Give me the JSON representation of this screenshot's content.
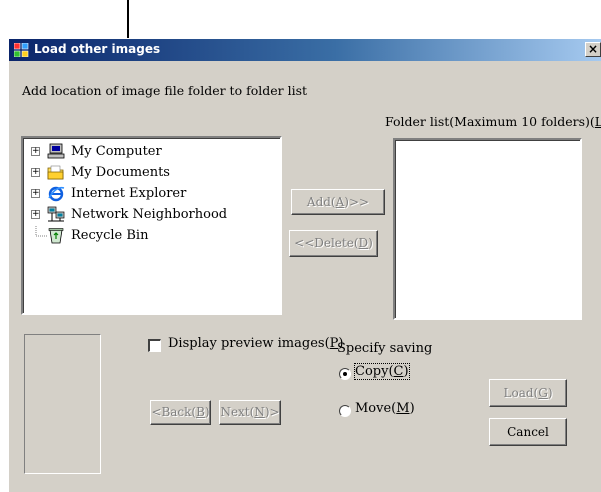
{
  "window": {
    "title": "Load other images",
    "close_glyph": "×"
  },
  "folder_location_label": "Add location of image file folder to folder list",
  "folder_list_label_prefix": "Folder list(Maximum 10 folders)(",
  "folder_list_label_key": "L",
  "folder_list_label_suffix": ")",
  "tree": [
    {
      "label": "My Computer",
      "icon": "my-computer-icon",
      "expandable": true
    },
    {
      "label": "My Documents",
      "icon": "folder-icon",
      "expandable": true
    },
    {
      "label": "Internet Explorer",
      "icon": "internet-explorer-icon",
      "expandable": true
    },
    {
      "label": "Network Neighborhood",
      "icon": "network-icon",
      "expandable": true
    },
    {
      "label": "Recycle Bin",
      "icon": "recycle-bin-icon",
      "expandable": false
    }
  ],
  "expand_glyph": "+",
  "buttons": {
    "add": {
      "prefix": "Add(",
      "key": "A",
      "suffix": ")>>"
    },
    "delete": {
      "prefix": "<<Delete(",
      "key": "D",
      "suffix": ")"
    },
    "back": {
      "prefix": "<Back(",
      "key": "B",
      "suffix": ")"
    },
    "next": {
      "prefix": "Next(",
      "key": "N",
      "suffix": ")>"
    },
    "load": {
      "prefix": "Load(",
      "key": "G",
      "suffix": ")"
    },
    "cancel": {
      "label": "Cancel"
    }
  },
  "preview_checkbox": {
    "prefix": "Display preview images(",
    "key": "P",
    "suffix": ")",
    "checked": false
  },
  "saving": {
    "label": "Specify saving",
    "copy": {
      "prefix": "Copy(",
      "key": "C",
      "suffix": ")",
      "selected": true
    },
    "move": {
      "prefix": "Move(",
      "key": "M",
      "suffix": ")",
      "selected": false
    }
  },
  "colors": {
    "face": "#d4d0c8",
    "title_start": "#0a246a",
    "title_end": "#a6caf0",
    "disabled_text": "#808080"
  }
}
